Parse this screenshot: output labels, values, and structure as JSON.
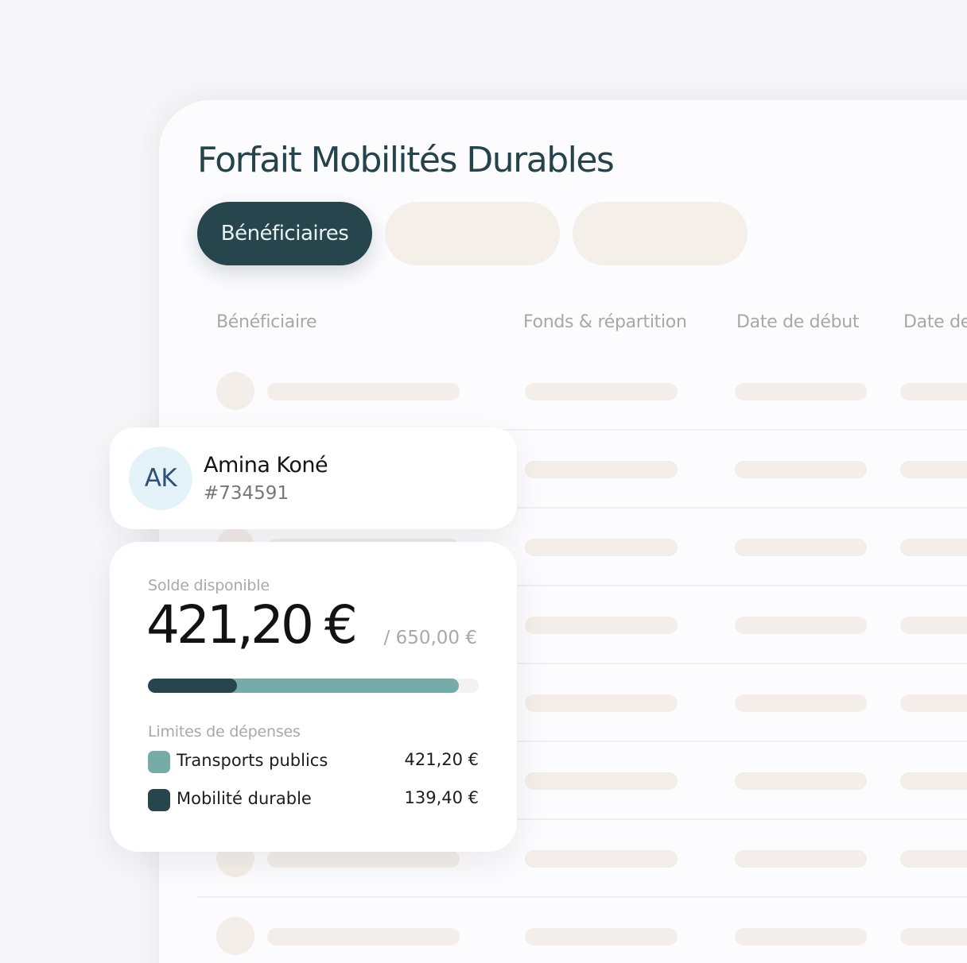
{
  "panel": {
    "title": "Forfait Mobilités Durables",
    "tabs": [
      {
        "label": "Bénéficiaires",
        "active": true
      },
      {
        "label": "",
        "active": false
      },
      {
        "label": "",
        "active": false
      }
    ],
    "columns": [
      "Bénéficiaire",
      "Fonds & répartition",
      "Date de début",
      "Date de"
    ]
  },
  "user_card": {
    "initials": "AK",
    "name": "Amina Koné",
    "id": "#734591"
  },
  "balance_card": {
    "label": "Solde disponible",
    "amount": "421,20 €",
    "total": "/ 650,00 €",
    "progress": {
      "dark_fraction": 0.27,
      "teal_fraction": 0.94
    },
    "limits_label": "Limites de dépenses",
    "limits": [
      {
        "label": "Transports publics",
        "value": "421,20 €",
        "color": "#75aca8"
      },
      {
        "label": "Mobilité durable",
        "value": "139,40 €",
        "color": "#27454d"
      }
    ]
  },
  "colors": {
    "accent_dark": "#27454d",
    "accent_teal": "#75aca8",
    "skeleton": "#f3eee9",
    "avatar_bg": "#e4f2f9"
  }
}
